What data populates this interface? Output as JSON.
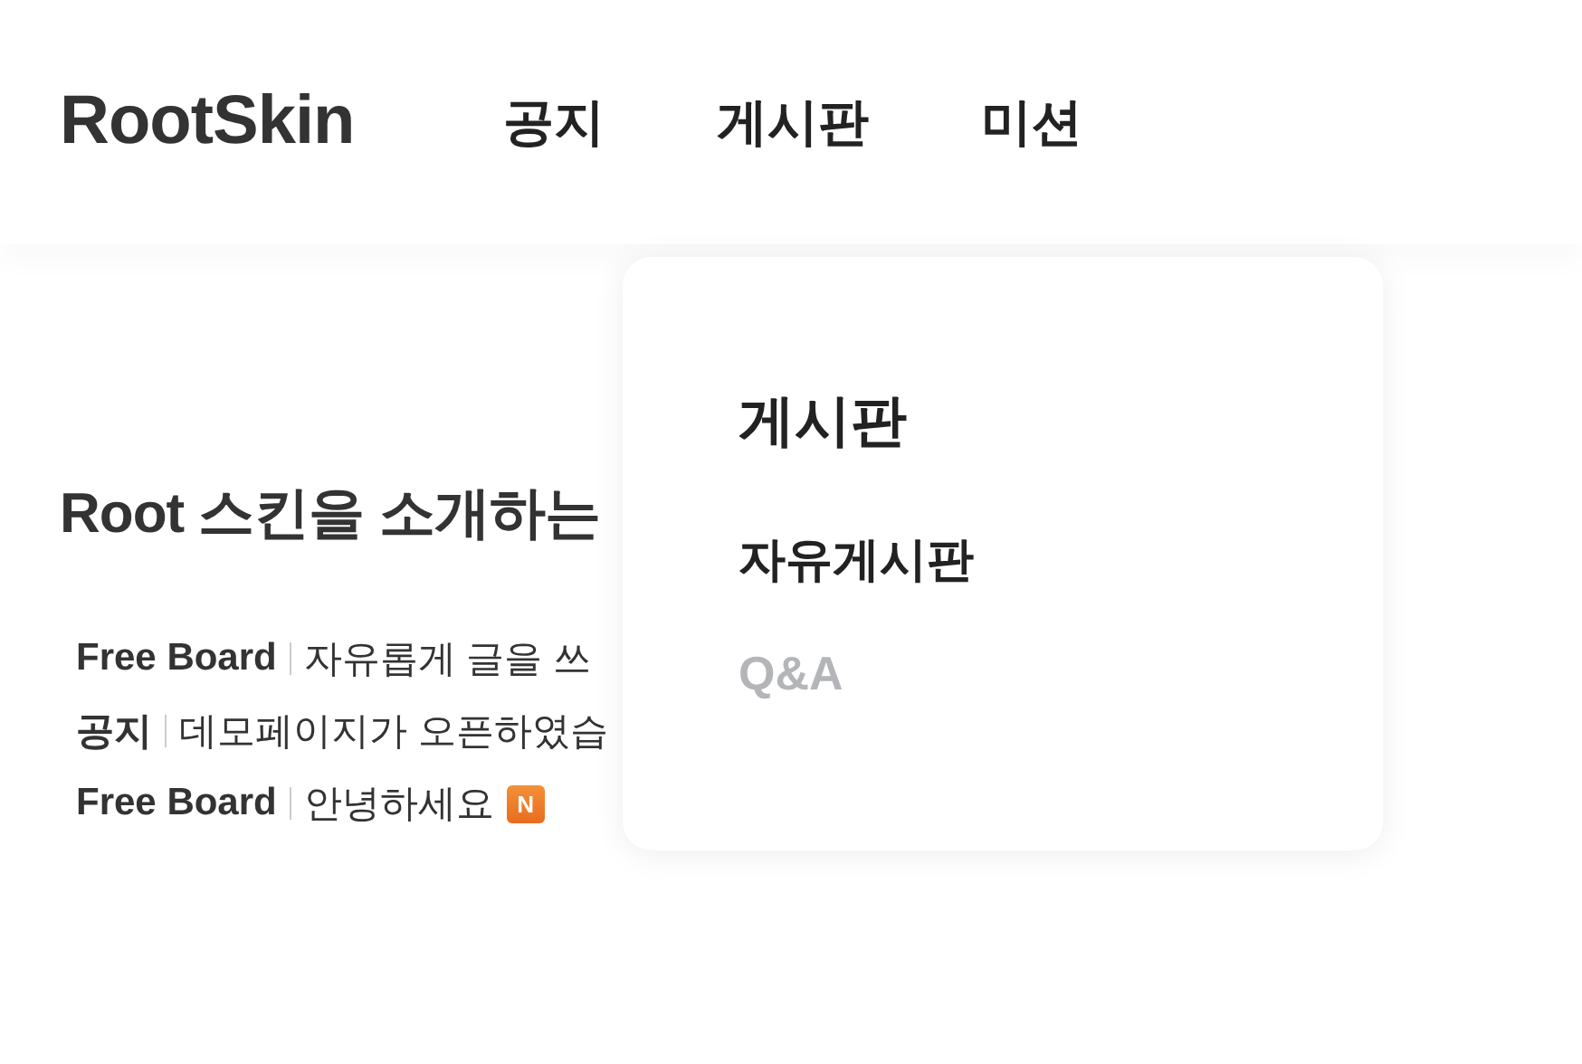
{
  "header": {
    "logo": "RootSkin",
    "nav": [
      {
        "label": "공지"
      },
      {
        "label": "게시판"
      },
      {
        "label": "미션"
      }
    ]
  },
  "section": {
    "title": "Root 스킨을 소개하는",
    "posts": [
      {
        "board": "Free Board",
        "title": "자유롭게 글을 쓰",
        "new": false
      },
      {
        "board": "공지",
        "title": "데모페이지가 오픈하였습",
        "new": false
      },
      {
        "board": "Free Board",
        "title": "안녕하세요",
        "new": true,
        "badge": "N"
      }
    ]
  },
  "dropdown": {
    "heading": "게시판",
    "items": [
      {
        "label": "자유게시판",
        "selected": true
      },
      {
        "label": "Q&A",
        "selected": false
      }
    ]
  }
}
